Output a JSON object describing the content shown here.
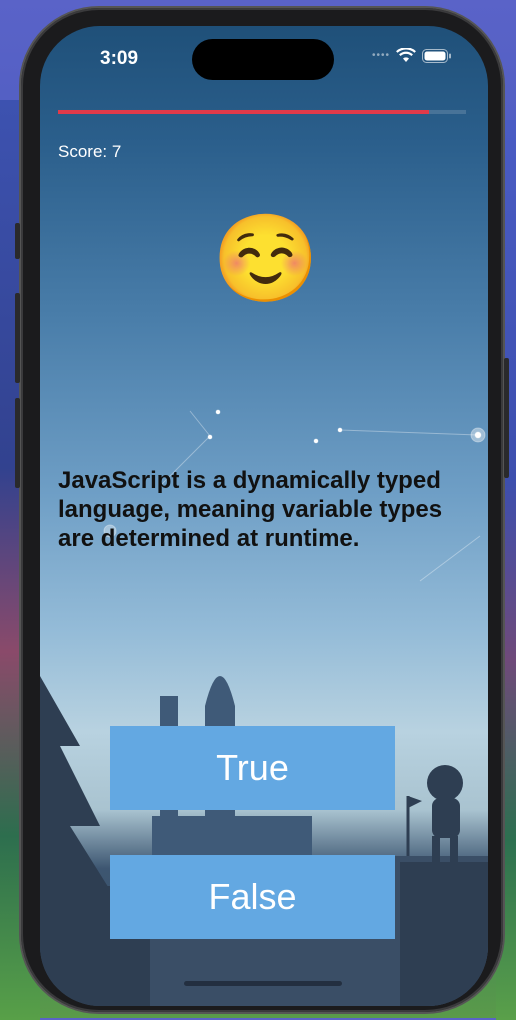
{
  "status_bar": {
    "time": "3:09"
  },
  "quiz": {
    "progress_fraction": 0.91,
    "score_label": "Score: 7",
    "emoji": "☺️",
    "question": "JavaScript is a dynamically typed language, meaning variable types are determined at runtime.",
    "answers": {
      "true_label": "True",
      "false_label": "False"
    }
  },
  "colors": {
    "progress": "#e03a4a",
    "button": "#63a8e2"
  }
}
